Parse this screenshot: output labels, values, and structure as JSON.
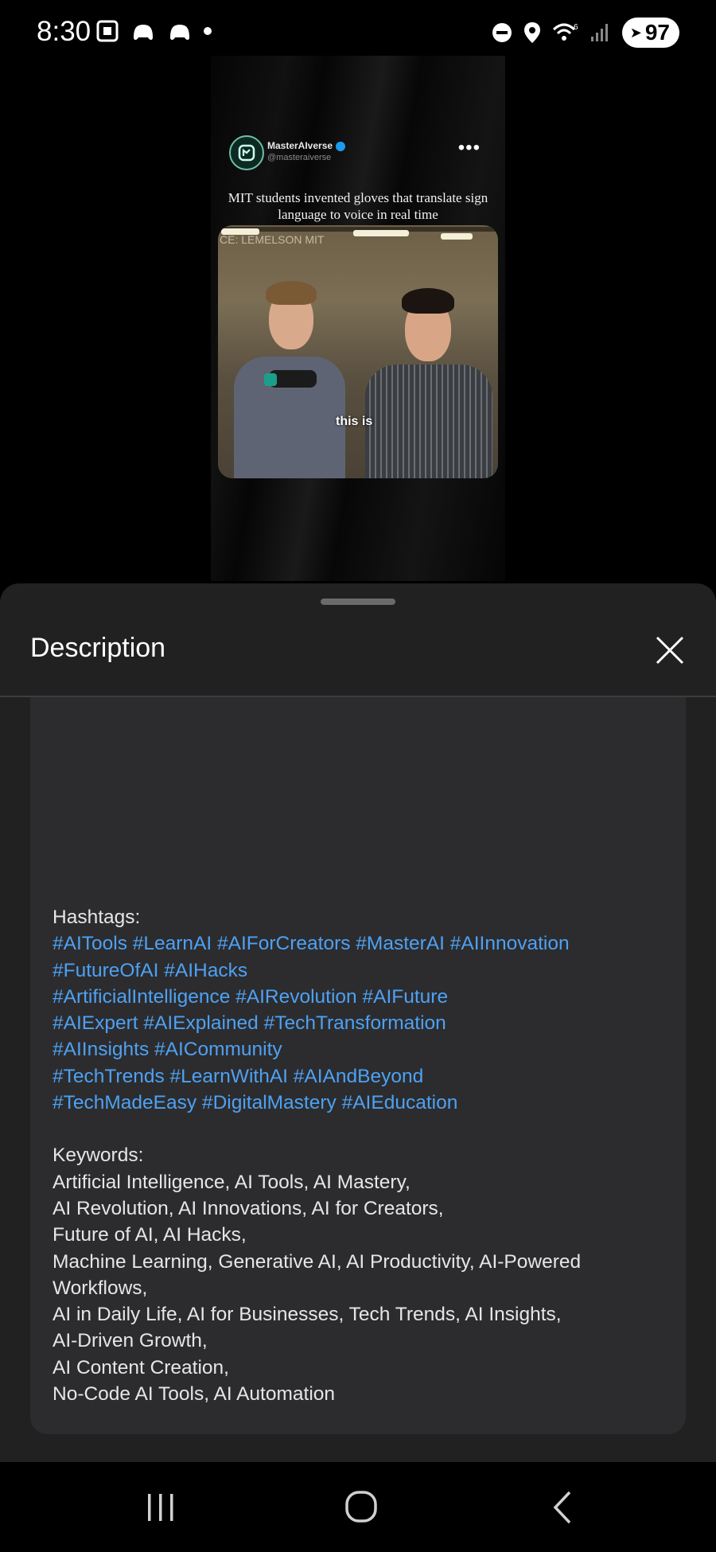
{
  "status_bar": {
    "time": "8:30",
    "battery": "97"
  },
  "video": {
    "account_name": "MasterAIverse",
    "account_handle": "@masteraiverse",
    "caption": "MIT students invented gloves that translate sign language to voice in real time",
    "source_label": "CE: LEMELSON MIT",
    "subtitle": "this is"
  },
  "sheet": {
    "title": "Description",
    "hashtags_label": "Hashtags:",
    "hashtag_lines": [
      "#AITools #LearnAI #AIForCreators #MasterAI #AIInnovation",
      "#FutureOfAI #AIHacks",
      "#ArtificialIntelligence #AIRevolution #AIFuture",
      "#AIExpert #AIExplained #TechTransformation",
      "#AIInsights #AICommunity",
      "#TechTrends #LearnWithAI #AIAndBeyond",
      "#TechMadeEasy #DigitalMastery #AIEducation"
    ],
    "keywords_label": "Keywords:",
    "keyword_lines": [
      "Artificial Intelligence, AI Tools, AI Mastery,",
      "AI Revolution, AI Innovations, AI for Creators,",
      "Future of AI, AI Hacks,",
      "Machine Learning, Generative AI, AI Productivity, AI-Powered",
      "Workflows,",
      "AI in Daily Life, AI for Businesses, Tech Trends, AI Insights,",
      "AI-Driven Growth,",
      "AI Content Creation,",
      "No-Code AI Tools, AI Automation"
    ]
  },
  "colors": {
    "hashtag": "#4ea1f3",
    "sheet_bg": "#212121",
    "desc_bg": "#2c2c2e"
  },
  "icons": [
    "screenshot-icon",
    "game-controller-icon",
    "notification-dot-icon",
    "do-not-disturb-icon",
    "location-icon",
    "wifi-icon",
    "signal-icon",
    "battery-icon",
    "more-options-icon",
    "close-icon",
    "recent-apps-icon",
    "home-icon",
    "back-icon"
  ]
}
